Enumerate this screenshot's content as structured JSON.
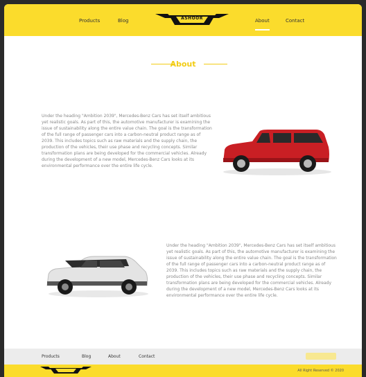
{
  "header": {
    "nav_left": [
      "Products",
      "Blog"
    ],
    "nav_right": [
      "About",
      "Contact"
    ],
    "logo_text": "ASHOOR",
    "active": "About"
  },
  "section": {
    "title": "About"
  },
  "content": {
    "paragraph_1": "Under the heading \"Ambition 2039\", Mercedes-Benz Cars has set itself ambitious yet realistic goals. As part of this, the automotive manufacturer is examining the issue of sustainability along the entire value chain. The goal is the transformation of the full range of passenger cars into a carbon-neutral product range as of 2039. This includes topics such as raw materials and the supply chain, the production of the vehicles, their use phase and recycling concepts. Similar transformation plans are being developed for the commercial vehicles. Already during the development of a new model, Mercedes-Benz Cars looks at its environmental performance over the entire life cycle.",
    "paragraph_2": "Under the heading \"Ambition 2039\", Mercedes-Benz Cars has set itself ambitious yet realistic goals. As part of this, the automotive manufacturer is examining the issue of sustainability along the entire value chain. The goal is the transformation of the full range of passenger cars into a carbon-neutral product range as of 2039. This includes topics such as raw materials and the supply chain, the production of the vehicles, their use phase and recycling concepts. Similar transformation plans are being developed for the commercial vehicles. Already during the development of a new model, Mercedes-Benz Cars looks at its environmental performance over the entire life cycle.",
    "car_1": "red-suv",
    "car_2": "white-suv"
  },
  "footer": {
    "links": [
      "Products",
      "Blog",
      "About",
      "Contact"
    ],
    "copyright": "All Right Reserved © 2020"
  },
  "colors": {
    "accent": "#fbdc2c",
    "title": "#f2cc14"
  }
}
